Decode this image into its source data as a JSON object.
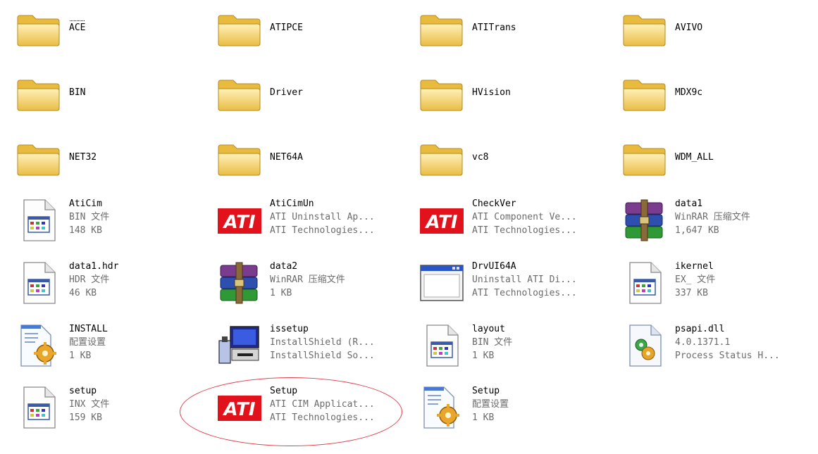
{
  "files": [
    {
      "name": "ACE",
      "type": "folder",
      "icon": "folder-icon",
      "focused": true
    },
    {
      "name": "ATIPCE",
      "type": "folder",
      "icon": "folder-icon"
    },
    {
      "name": "ATITrans",
      "type": "folder",
      "icon": "folder-icon"
    },
    {
      "name": "AVIVO",
      "type": "folder",
      "icon": "folder-icon"
    },
    {
      "name": "BIN",
      "type": "folder",
      "icon": "folder-icon"
    },
    {
      "name": "Driver",
      "type": "folder",
      "icon": "folder-icon"
    },
    {
      "name": "HVision",
      "type": "folder",
      "icon": "folder-icon"
    },
    {
      "name": "MDX9c",
      "type": "folder",
      "icon": "folder-icon"
    },
    {
      "name": "NET32",
      "type": "folder",
      "icon": "folder-icon"
    },
    {
      "name": "NET64A",
      "type": "folder",
      "icon": "folder-icon"
    },
    {
      "name": "vc8",
      "type": "folder",
      "icon": "folder-icon"
    },
    {
      "name": "WDM_ALL",
      "type": "folder",
      "icon": "folder-icon"
    },
    {
      "name": "AtiCim",
      "type": "file",
      "icon": "generic-file-icon",
      "line1": "BIN 文件",
      "line2": "148 KB"
    },
    {
      "name": "AtiCimUn",
      "type": "file",
      "icon": "ati-logo-icon",
      "line1": "ATI Uninstall Ap...",
      "line2": "ATI Technologies..."
    },
    {
      "name": "CheckVer",
      "type": "file",
      "icon": "ati-logo-icon",
      "line1": "ATI Component Ve...",
      "line2": "ATI Technologies..."
    },
    {
      "name": "data1",
      "type": "file",
      "icon": "winrar-archive-icon",
      "line1": "WinRAR 压缩文件",
      "line2": "1,647 KB"
    },
    {
      "name": "data1.hdr",
      "type": "file",
      "icon": "generic-file-icon",
      "line1": "HDR 文件",
      "line2": "46 KB"
    },
    {
      "name": "data2",
      "type": "file",
      "icon": "winrar-archive-icon",
      "line1": "WinRAR 压缩文件",
      "line2": "1 KB"
    },
    {
      "name": "DrvUI64A",
      "type": "file",
      "icon": "application-window-icon",
      "line1": "Uninstall ATI Di...",
      "line2": "ATI Technologies..."
    },
    {
      "name": "ikernel",
      "type": "file",
      "icon": "generic-file-icon",
      "line1": "EX_ 文件",
      "line2": "337 KB"
    },
    {
      "name": "INSTALL",
      "type": "file",
      "icon": "config-settings-icon",
      "line1": "配置设置",
      "line2": "1 KB"
    },
    {
      "name": "issetup",
      "type": "file",
      "icon": "installshield-icon",
      "line1": "InstallShield (R...",
      "line2": "InstallShield So..."
    },
    {
      "name": "layout",
      "type": "file",
      "icon": "generic-file-icon",
      "line1": "BIN 文件",
      "line2": "1 KB"
    },
    {
      "name": "psapi.dll",
      "type": "file",
      "icon": "dll-gear-icon",
      "line1": "4.0.1371.1",
      "line2": "Process Status H..."
    },
    {
      "name": "setup",
      "type": "file",
      "icon": "generic-file-icon",
      "line1": "INX 文件",
      "line2": "159 KB"
    },
    {
      "name": "Setup",
      "type": "file",
      "icon": "ati-logo-icon",
      "line1": "ATI CIM Applicat...",
      "line2": "ATI Technologies...",
      "highlighted": true
    },
    {
      "name": "Setup",
      "type": "file",
      "icon": "config-settings-icon",
      "line1": "配置设置",
      "line2": "1 KB"
    }
  ],
  "colors": {
    "highlight_ellipse": "#e03b4a",
    "ati_red": "#e2121c",
    "folder_yellow": "#f6d66a"
  }
}
